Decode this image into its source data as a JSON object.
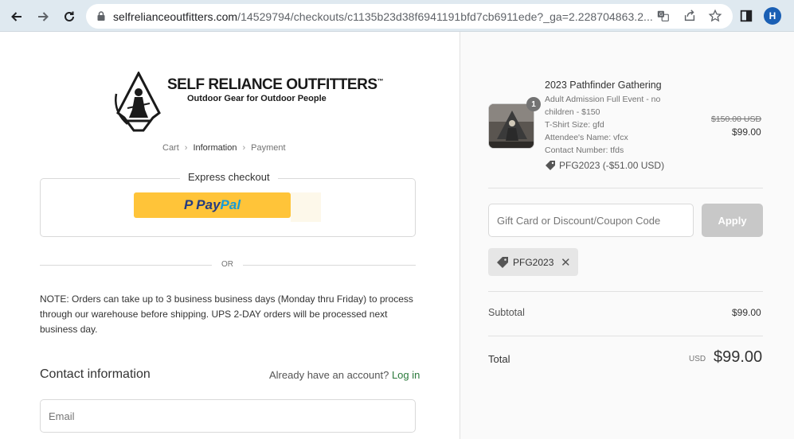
{
  "browser": {
    "url_domain": "selfrelianceoutfitters.com",
    "url_path": "/14529794/checkouts/c1135b23d38f6941191bfd7cb6911ede?_ga=2.228704863.2...",
    "profile_initial": "H",
    "icons": [
      "back-icon",
      "forward-icon",
      "reload-icon",
      "lock-icon",
      "translate-icon",
      "share-icon",
      "star-icon",
      "sidebar-icon"
    ]
  },
  "store": {
    "brand": "SELF RELIANCE OUTFITTERS",
    "trademark": "™",
    "tagline": "Outdoor Gear for Outdoor People"
  },
  "breadcrumb": {
    "cart": "Cart",
    "information": "Information",
    "payment": "Payment"
  },
  "express": {
    "label": "Express checkout",
    "paypal_pay": "Pay",
    "paypal_pal": "Pal"
  },
  "divider_text": "OR",
  "note": "NOTE: Orders can take up to 3 business business days (Monday thru Friday) to process through our warehouse before shipping. UPS 2-DAY orders will be processed next business day.",
  "contact": {
    "title": "Contact information",
    "account_prompt": "Already have an account?",
    "login_link": "Log in",
    "email_placeholder": "Email"
  },
  "order": {
    "product": {
      "name": "2023 Pathfinder Gathering",
      "quantity": "1",
      "details": [
        "Adult Admission Full Event - no children - $150",
        "T-Shirt Size: gfd",
        "Attendee's Name: vfcx",
        "Contact Number: tfds"
      ],
      "discount": "PFG2023 (-$51.00 USD)",
      "original_price": "$150.00 USD",
      "price": "$99.00"
    },
    "code_placeholder": "Gift Card or Discount/Coupon Code",
    "apply_label": "Apply",
    "applied_code": "PFG2023",
    "subtotal_label": "Subtotal",
    "subtotal_value": "$99.00",
    "total_label": "Total",
    "currency": "USD",
    "total_value": "$99.00"
  },
  "colors": {
    "chrome": "#dfe9f0",
    "paypal_yellow": "#ffc439",
    "login_link": "#2a7a3b",
    "apply_disabled": "#c8c8c8"
  }
}
